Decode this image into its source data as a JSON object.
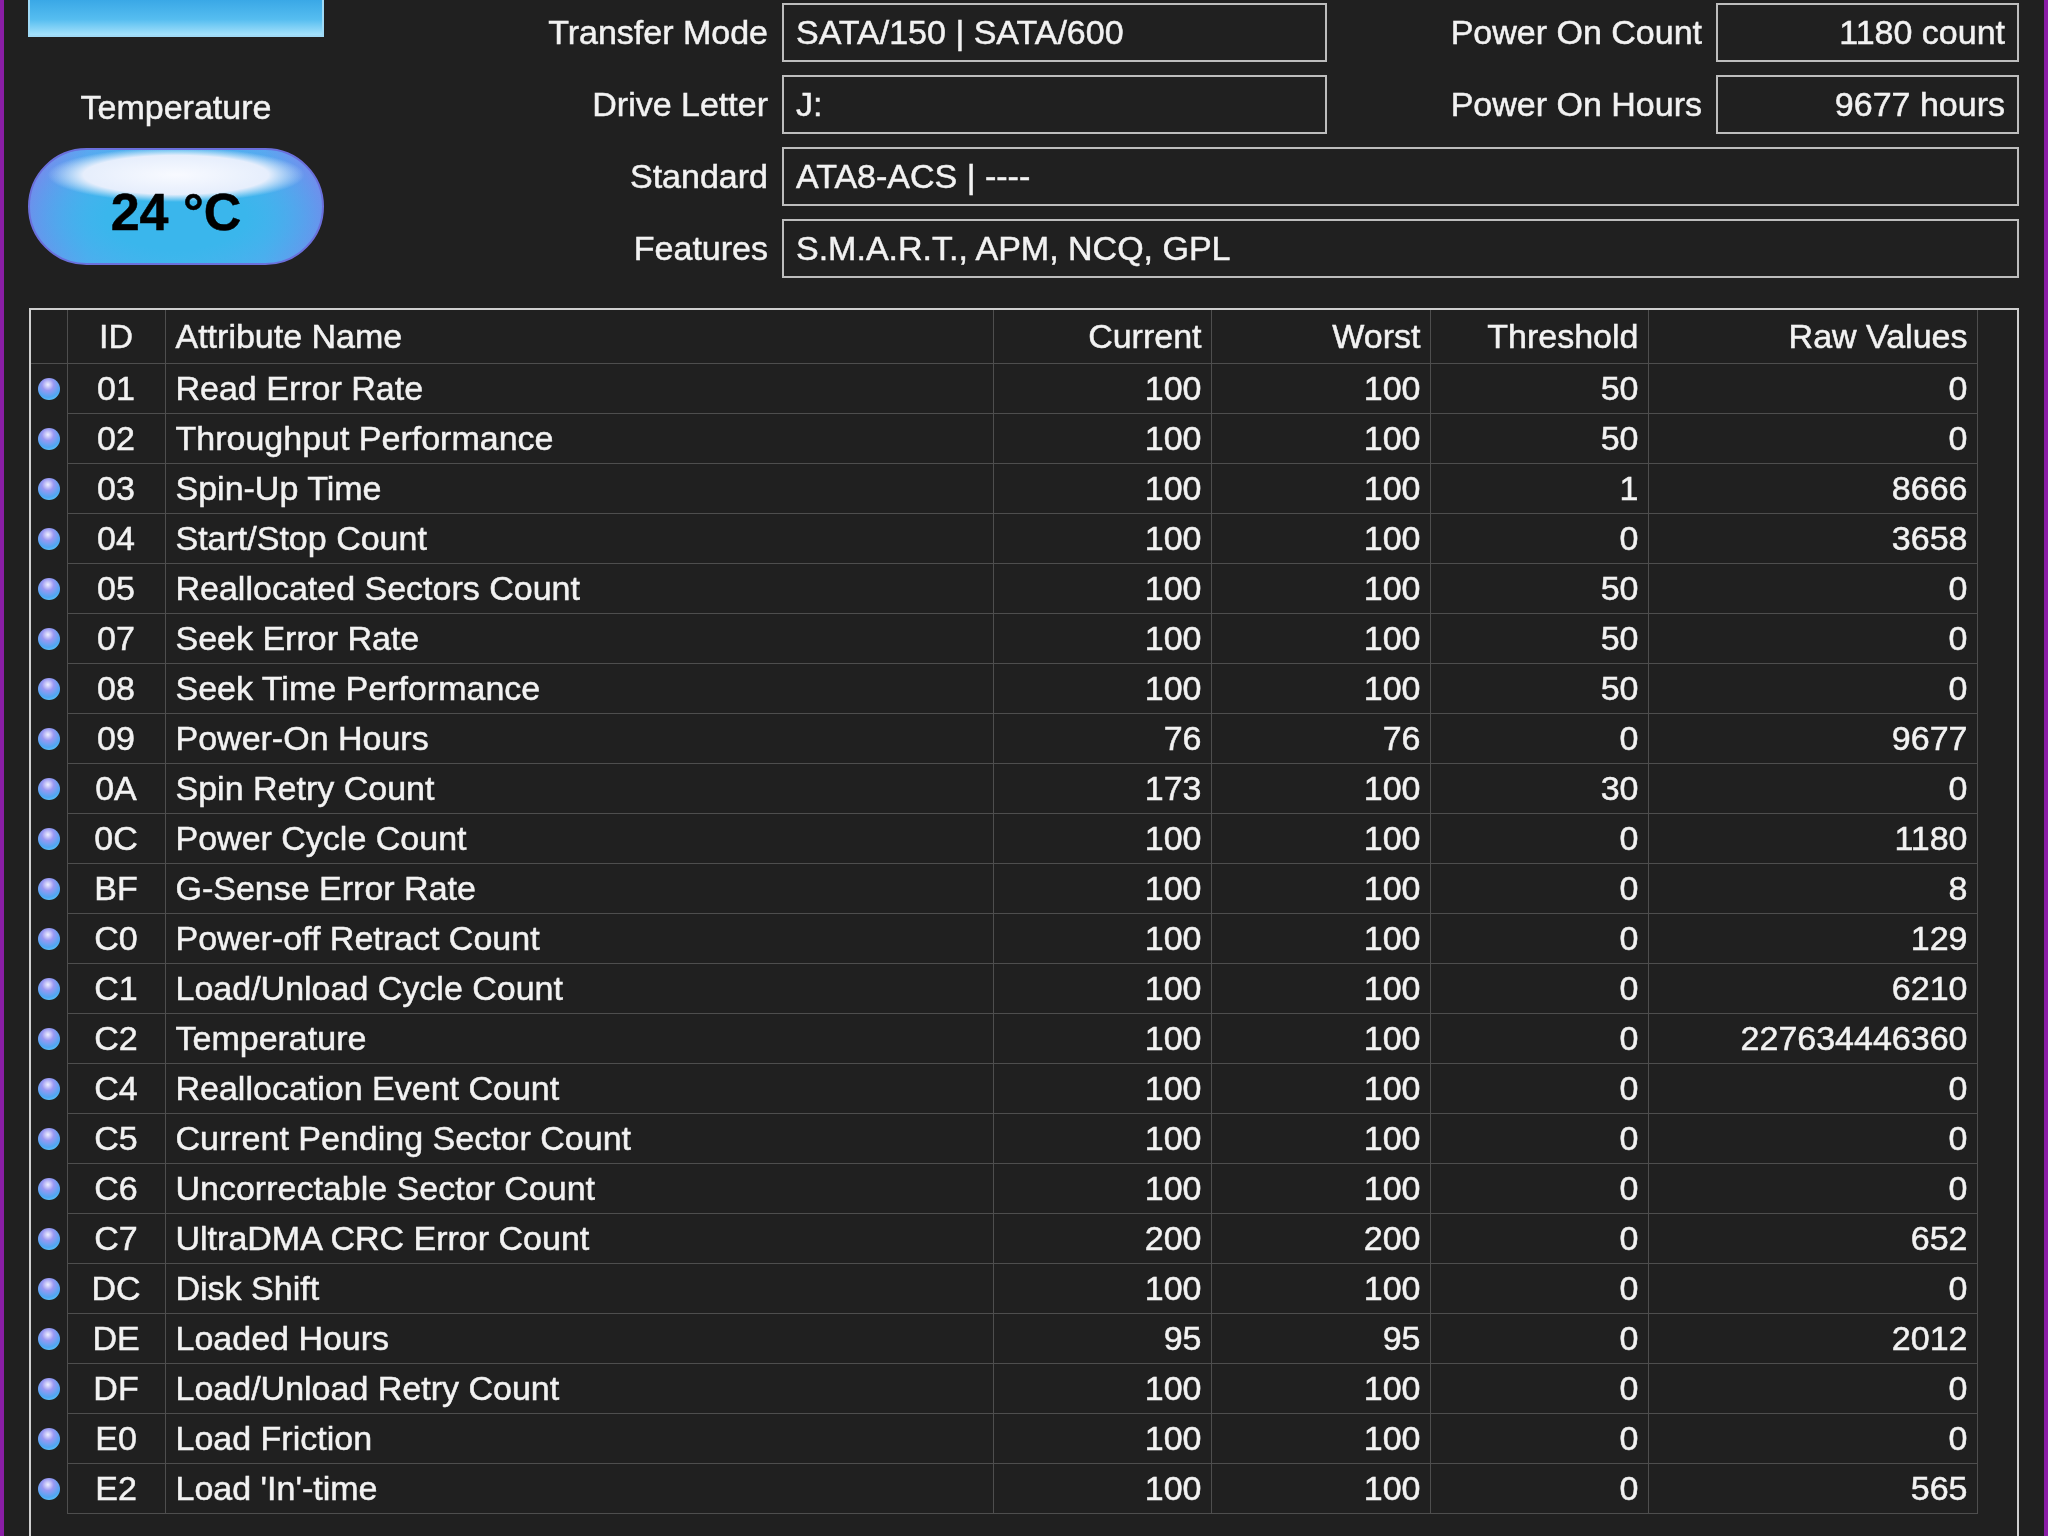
{
  "temperature": {
    "label": "Temperature",
    "value": "24 °C"
  },
  "info_rows": [
    {
      "label": "Transfer Mode",
      "value": "SATA/150 | SATA/600",
      "side": {
        "label": "Power On Count",
        "value": "1180 count"
      }
    },
    {
      "label": "Drive Letter",
      "value": "J:",
      "side": {
        "label": "Power On Hours",
        "value": "9677 hours"
      }
    },
    {
      "label": "Standard",
      "value": "ATA8-ACS | ----"
    },
    {
      "label": "Features",
      "value": "S.M.A.R.T., APM, NCQ, GPL"
    }
  ],
  "smart_table": {
    "columns": [
      "ID",
      "Attribute Name",
      "Current",
      "Worst",
      "Threshold",
      "Raw Values"
    ],
    "rows": [
      {
        "id": "01",
        "name": "Read Error Rate",
        "current": "100",
        "worst": "100",
        "threshold": "50",
        "raw": "0"
      },
      {
        "id": "02",
        "name": "Throughput Performance",
        "current": "100",
        "worst": "100",
        "threshold": "50",
        "raw": "0"
      },
      {
        "id": "03",
        "name": "Spin-Up Time",
        "current": "100",
        "worst": "100",
        "threshold": "1",
        "raw": "8666"
      },
      {
        "id": "04",
        "name": "Start/Stop Count",
        "current": "100",
        "worst": "100",
        "threshold": "0",
        "raw": "3658"
      },
      {
        "id": "05",
        "name": "Reallocated Sectors Count",
        "current": "100",
        "worst": "100",
        "threshold": "50",
        "raw": "0"
      },
      {
        "id": "07",
        "name": "Seek Error Rate",
        "current": "100",
        "worst": "100",
        "threshold": "50",
        "raw": "0"
      },
      {
        "id": "08",
        "name": "Seek Time Performance",
        "current": "100",
        "worst": "100",
        "threshold": "50",
        "raw": "0"
      },
      {
        "id": "09",
        "name": "Power-On Hours",
        "current": "76",
        "worst": "76",
        "threshold": "0",
        "raw": "9677"
      },
      {
        "id": "0A",
        "name": "Spin Retry Count",
        "current": "173",
        "worst": "100",
        "threshold": "30",
        "raw": "0"
      },
      {
        "id": "0C",
        "name": "Power Cycle Count",
        "current": "100",
        "worst": "100",
        "threshold": "0",
        "raw": "1180"
      },
      {
        "id": "BF",
        "name": "G-Sense Error Rate",
        "current": "100",
        "worst": "100",
        "threshold": "0",
        "raw": "8"
      },
      {
        "id": "C0",
        "name": "Power-off Retract Count",
        "current": "100",
        "worst": "100",
        "threshold": "0",
        "raw": "129"
      },
      {
        "id": "C1",
        "name": "Load/Unload Cycle Count",
        "current": "100",
        "worst": "100",
        "threshold": "0",
        "raw": "6210"
      },
      {
        "id": "C2",
        "name": "Temperature",
        "current": "100",
        "worst": "100",
        "threshold": "0",
        "raw": "227634446360"
      },
      {
        "id": "C4",
        "name": "Reallocation Event Count",
        "current": "100",
        "worst": "100",
        "threshold": "0",
        "raw": "0"
      },
      {
        "id": "C5",
        "name": "Current Pending Sector Count",
        "current": "100",
        "worst": "100",
        "threshold": "0",
        "raw": "0"
      },
      {
        "id": "C6",
        "name": "Uncorrectable Sector Count",
        "current": "100",
        "worst": "100",
        "threshold": "0",
        "raw": "0"
      },
      {
        "id": "C7",
        "name": "UltraDMA CRC Error Count",
        "current": "200",
        "worst": "200",
        "threshold": "0",
        "raw": "652"
      },
      {
        "id": "DC",
        "name": "Disk Shift",
        "current": "100",
        "worst": "100",
        "threshold": "0",
        "raw": "0"
      },
      {
        "id": "DE",
        "name": "Loaded Hours",
        "current": "95",
        "worst": "95",
        "threshold": "0",
        "raw": "2012"
      },
      {
        "id": "DF",
        "name": "Load/Unload Retry Count",
        "current": "100",
        "worst": "100",
        "threshold": "0",
        "raw": "0"
      },
      {
        "id": "E0",
        "name": "Load Friction",
        "current": "100",
        "worst": "100",
        "threshold": "0",
        "raw": "0"
      },
      {
        "id": "E2",
        "name": "Load 'In'-time",
        "current": "100",
        "worst": "100",
        "threshold": "0",
        "raw": "565"
      }
    ]
  }
}
